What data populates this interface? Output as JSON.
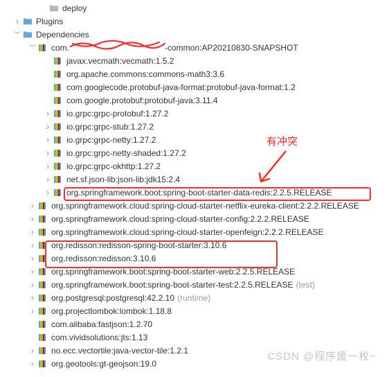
{
  "tree": {
    "deploy": "deploy",
    "plugins": "Plugins",
    "dependencies": "Dependencies",
    "root_prefix": "com.",
    "root_suffix": "-common:AP20210830-SNAPSHOT",
    "items": [
      "javax.vecmath:vecmath:1.5.2",
      "org.apache.commons:commons-math3:3.6",
      "com.googlecode.protobuf-java-format:protobuf-java-format:1.2",
      "com.google.protobuf:protobuf-java:3.11.4",
      "io.grpc:grpc-protobuf:1.27.2",
      "io.grpc:grpc-stub:1.27.2",
      "io.grpc:grpc-netty:1.27.2",
      "io.grpc:grpc-netty-shaded:1.27.2",
      "io.grpc:grpc-okhttp:1.27.2",
      "net.sf.json-lib:json-lib:jdk15:2.4",
      "org.springframework.boot:spring-boot-starter-data-redis:2.2.5.RELEASE"
    ],
    "level2": [
      "org.springframework.cloud:spring-cloud-starter-netflix-eureka-client:2.2.2.RELEASE",
      "org.springframework.cloud:spring-cloud-starter-config:2.2.2.RELEASE",
      "org.springframework.cloud:spring-cloud-starter-openfeign:2.2.2.RELEASE",
      "org.redisson:redisson-spring-boot-starter:3.10.6",
      "org.redisson:redisson:3.10.6",
      "org.springframework.boot:spring-boot-starter-web:2.2.5.RELEASE",
      "org.springframework.boot:spring-boot-starter-test:2.2.5.RELEASE",
      "org.postgresql:postgresql:42.2.10",
      "org.projectlombok:lombok:1.18.8",
      "com.alibaba:fastjson:1.2.70",
      "com.vividsolutions:jts:1.13",
      "no.ecc.vectortile:java-vector-tile:1.2.1",
      "org.geotools:gt-geojson:19.0"
    ],
    "notes": {
      "test": "(test)",
      "runtime": "(runtime)"
    }
  },
  "annotation": {
    "conflict": "有冲突"
  },
  "watermark": "CSDN @程序媛一枚~"
}
